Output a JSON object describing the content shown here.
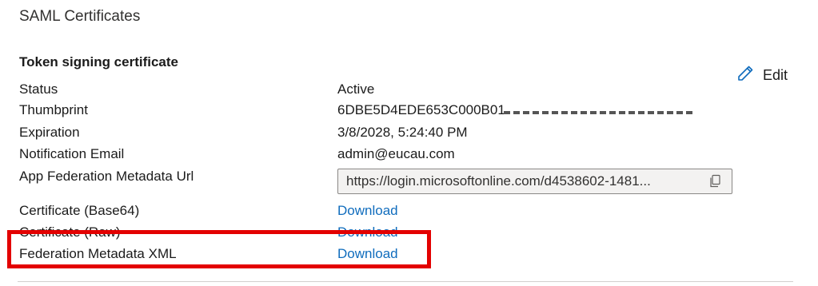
{
  "section": {
    "title": "SAML Certificates"
  },
  "card": {
    "title": "Token signing certificate",
    "edit_label": "Edit",
    "edit_icon": "pencil-icon",
    "rows": {
      "status": {
        "label": "Status",
        "value": "Active"
      },
      "thumbprint": {
        "label": "Thumbprint",
        "value": "6DBE5D4EDE653C000B01"
      },
      "expiration": {
        "label": "Expiration",
        "value": "3/8/2028, 5:24:40 PM"
      },
      "notification_email": {
        "label": "Notification Email",
        "value": "admin@eucau.com"
      },
      "metadata_url": {
        "label": "App Federation Metadata Url",
        "value": "https://login.microsoftonline.com/d4538602-1481..."
      },
      "cert_base64": {
        "label": "Certificate (Base64)",
        "link": "Download"
      },
      "cert_raw": {
        "label": "Certificate (Raw)",
        "link": "Download"
      },
      "federation_xml": {
        "label": "Federation Metadata XML",
        "link": "Download"
      }
    },
    "copy_icon": "copy-icon"
  },
  "colors": {
    "link": "#0f6cbd",
    "highlight": "#e30000",
    "text": "#1b1b1b"
  }
}
